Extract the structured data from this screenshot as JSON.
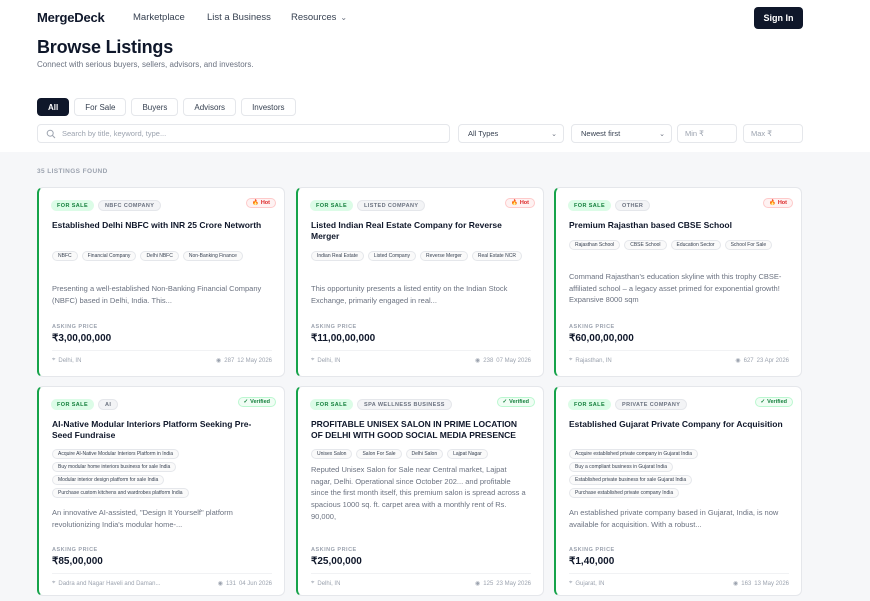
{
  "header": {
    "logo": "MergeDeck",
    "nav": [
      "Marketplace",
      "List a Business",
      "Resources"
    ],
    "signin_label": "Sign In"
  },
  "page": {
    "title": "Browse Listings",
    "subtitle": "Connect with serious buyers, sellers, advisors, and investors."
  },
  "tabs": [
    {
      "label": "All",
      "active": true
    },
    {
      "label": "For Sale",
      "active": false
    },
    {
      "label": "Buyers",
      "active": false
    },
    {
      "label": "Advisors",
      "active": false
    },
    {
      "label": "Investors",
      "active": false
    }
  ],
  "filters": {
    "search_placeholder": "Search by title, keyword, type...",
    "type_value": "All Types",
    "sort_value": "Newest first",
    "min_placeholder": "Min ₹",
    "max_placeholder": "Max ₹"
  },
  "results": {
    "count_label": "35 LISTINGS FOUND"
  },
  "asking_label": "ASKING PRICE",
  "cards": [
    {
      "status": "FOR SALE",
      "category": "NBFC COMPANY",
      "flag": "Hot",
      "flag_type": "hot",
      "title": "Established Delhi NBFC with INR 25 Crore Networth",
      "tags": [
        "NBFC",
        "Financial Company",
        "Delhi NBFC",
        "Non-Banking Finance"
      ],
      "description": "Presenting a well-established Non-Banking Financial Company (NBFC) based in Delhi, India. This...",
      "price": "₹3,00,00,000",
      "location": "Delhi, IN",
      "views": "287",
      "date": "12 May 2026"
    },
    {
      "status": "FOR SALE",
      "category": "LISTED COMPANY",
      "flag": "Hot",
      "flag_type": "hot",
      "title": "Listed Indian Real Estate Company for Reverse Merger",
      "tags": [
        "Indian Real Estate",
        "Listed Company",
        "Reverse Merger",
        "Real Estate NCR"
      ],
      "description": "This opportunity presents a listed entity on the Indian Stock Exchange, primarily engaged in real...",
      "price": "₹11,00,00,000",
      "location": "Delhi, IN",
      "views": "238",
      "date": "07 May 2026"
    },
    {
      "status": "FOR SALE",
      "category": "OTHER",
      "flag": "Hot",
      "flag_type": "hot",
      "title": "Premium Rajasthan based CBSE School",
      "tags": [
        "Rajasthan School",
        "CBSE School",
        "Education Sector",
        "School For Sale"
      ],
      "description": "Command Rajasthan's education skyline with this trophy CBSE-affiliated school – a legacy asset primed for exponential growth! Expansive 8000 sqm",
      "price": "₹60,00,00,000",
      "location": "Rajasthan, IN",
      "views": "627",
      "date": "23 Apr 2026"
    },
    {
      "status": "FOR SALE",
      "category": "AI",
      "flag": "Verified",
      "flag_type": "verified",
      "title": "AI-Native Modular Interiors Platform Seeking Pre-Seed Fundraise",
      "tags": [
        "Acquire AI-Native Modular Interiors Platform in India",
        "Buy modular home interiors business for sale India",
        "Modular interior design platform for sale India",
        "Purchase custom kitchens and wardrobes platform India"
      ],
      "description": "An innovative AI-assisted, \"Design It Yourself\" platform revolutionizing India's modular home-...",
      "price": "₹85,00,000",
      "location": "Dadra and Nagar Haveli and Daman...",
      "views": "131",
      "date": "04 Jun 2026"
    },
    {
      "status": "FOR SALE",
      "category": "SPA WELLNESS BUSINESS",
      "flag": "Verified",
      "flag_type": "verified",
      "title": "PROFITABLE UNISEX SALON IN PRIME LOCATION OF DELHI WITH GOOD SOCIAL MEDIA PRESENCE",
      "tags": [
        "Unisex Salon",
        "Salon For Sale",
        "Delhi Salon",
        "Lajpat Nagar"
      ],
      "description": "Reputed Unisex Salon for Sale near Central market, Lajpat nagar, Delhi. Operational since October 202... and profitable since the first month itself, this premium salon is spread across a spacious 1000 sq. ft. carpet area with a monthly rent of Rs. 90,000,",
      "price": "₹25,00,000",
      "location": "Delhi, IN",
      "views": "125",
      "date": "23 May 2026"
    },
    {
      "status": "FOR SALE",
      "category": "PRIVATE COMPANY",
      "flag": "Verified",
      "flag_type": "verified",
      "title": "Established Gujarat Private Company for Acquisition",
      "tags": [
        "Acquire established private company in Gujarat India",
        "Buy a compliant business in Gujarat India",
        "Established private business for sale Gujarat India",
        "Purchase established private company India"
      ],
      "description": "An established private company based in Gujarat, India, is now available for acquisition. With a robust...",
      "price": "₹1,40,000",
      "location": "Gujarat, IN",
      "views": "163",
      "date": "13 May 2026"
    }
  ]
}
